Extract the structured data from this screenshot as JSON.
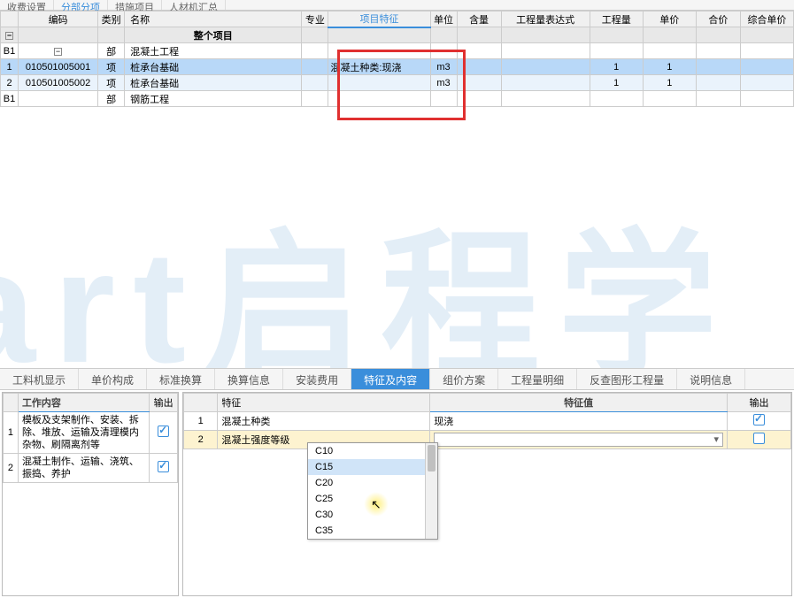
{
  "top_tabs": [
    "收费设置",
    "分部分项",
    "措施项目",
    "人材机汇总"
  ],
  "main_headers": {
    "code": "编码",
    "type": "类别",
    "name": "名称",
    "spec": "专业",
    "feature": "项目特征",
    "unit": "单位",
    "content": "含量",
    "expr": "工程量表达式",
    "qty": "工程量",
    "unitprice": "单价",
    "total": "合价",
    "comp": "综合单价"
  },
  "section_title": "整个项目",
  "rows": [
    {
      "idx": "B1",
      "type": "部",
      "name": "混凝土工程",
      "is_group": true
    },
    {
      "idx": "1",
      "code": "010501005001",
      "type": "项",
      "name": "桩承台基础",
      "feature": "混凝土种类:现浇",
      "unit": "m3",
      "qty": "1",
      "unitprice": "1",
      "selected": true
    },
    {
      "idx": "2",
      "code": "010501005002",
      "type": "项",
      "name": "桩承台基础",
      "unit": "m3",
      "qty": "1",
      "unitprice": "1",
      "alt": true
    },
    {
      "idx": "B1",
      "type": "部",
      "name": "钢筋工程",
      "is_group": true
    }
  ],
  "bottom_tabs": [
    "工料机显示",
    "单价构成",
    "标准换算",
    "换算信息",
    "安装费用",
    "特征及内容",
    "组价方案",
    "工程量明细",
    "反查图形工程量",
    "说明信息"
  ],
  "bottom_active_idx": 5,
  "work_panel": {
    "headers": {
      "work": "工作内容",
      "out": "输出"
    },
    "items": [
      "模板及支架制作、安装、拆除、堆放、运输及清理模内杂物、刷隔离剂等",
      "混凝土制作、运输、浇筑、振捣、养护"
    ]
  },
  "feat_panel": {
    "headers": {
      "feat": "特征",
      "val": "特征值",
      "out": "输出"
    },
    "rows": [
      {
        "idx": "1",
        "feat": "混凝土种类",
        "val": "现浇",
        "checked": true
      },
      {
        "idx": "2",
        "feat": "混凝土强度等级",
        "val": "",
        "checked": false,
        "editing": true
      }
    ]
  },
  "dropdown_options": [
    "C10",
    "C15",
    "C20",
    "C25",
    "C30",
    "C35"
  ],
  "dropdown_hover_idx": 1
}
